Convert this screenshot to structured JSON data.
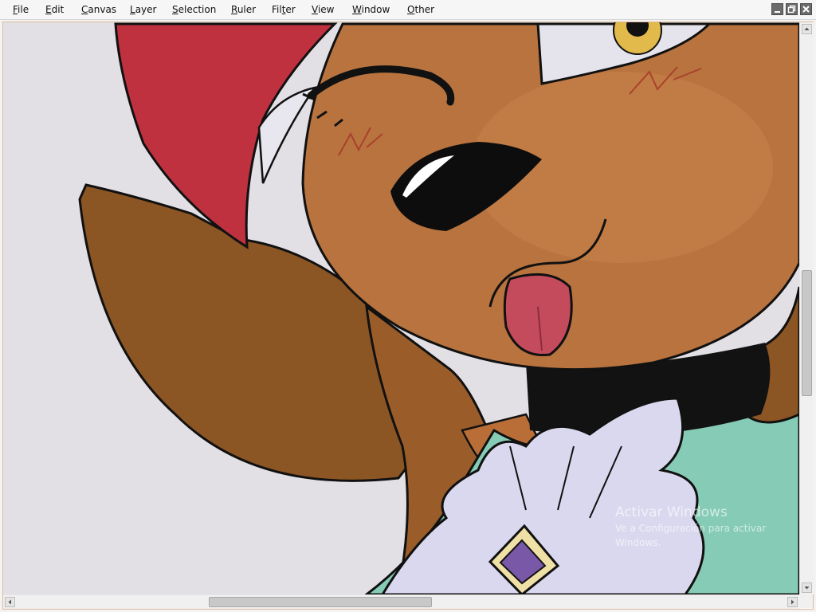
{
  "menubar": {
    "items": [
      {
        "id": "file",
        "first": "F",
        "rest": "ile"
      },
      {
        "id": "edit",
        "first": "E",
        "rest": "dit"
      },
      {
        "id": "canvas",
        "first": "C",
        "rest": "anvas"
      },
      {
        "id": "layer",
        "first": "L",
        "rest": "ayer"
      },
      {
        "id": "selection",
        "first": "S",
        "rest": "election"
      },
      {
        "id": "ruler",
        "first": "R",
        "rest": "uler"
      },
      {
        "id": "filter",
        "first": "Fil",
        "mid": "t",
        "rest": "er"
      },
      {
        "id": "view",
        "first": "V",
        "rest": "iew"
      },
      {
        "id": "window",
        "first": "W",
        "rest": "indow"
      },
      {
        "id": "other",
        "first": "O",
        "rest": "ther"
      }
    ],
    "window_controls": [
      "minimize-icon",
      "restore-icon",
      "close-icon"
    ]
  },
  "scrollbars": {
    "vertical": {
      "thumb_start": 0.43,
      "thumb_end": 0.66
    },
    "horizontal": {
      "thumb_start": 0.25,
      "thumb_end": 0.54
    }
  },
  "watermark": {
    "title": "Activar Windows",
    "subtitle": "Ve a Configuración para activar Windows."
  },
  "colors": {
    "skin": "#b8733f",
    "hair": "#8c5524",
    "background": "#e2e0e5",
    "red_quill": "#c03140",
    "collar": "#121212",
    "shirt": "#86cbb6",
    "tongue": "#c34b5c",
    "fur": "#d9d8ee",
    "gem": "#7a58a8"
  }
}
